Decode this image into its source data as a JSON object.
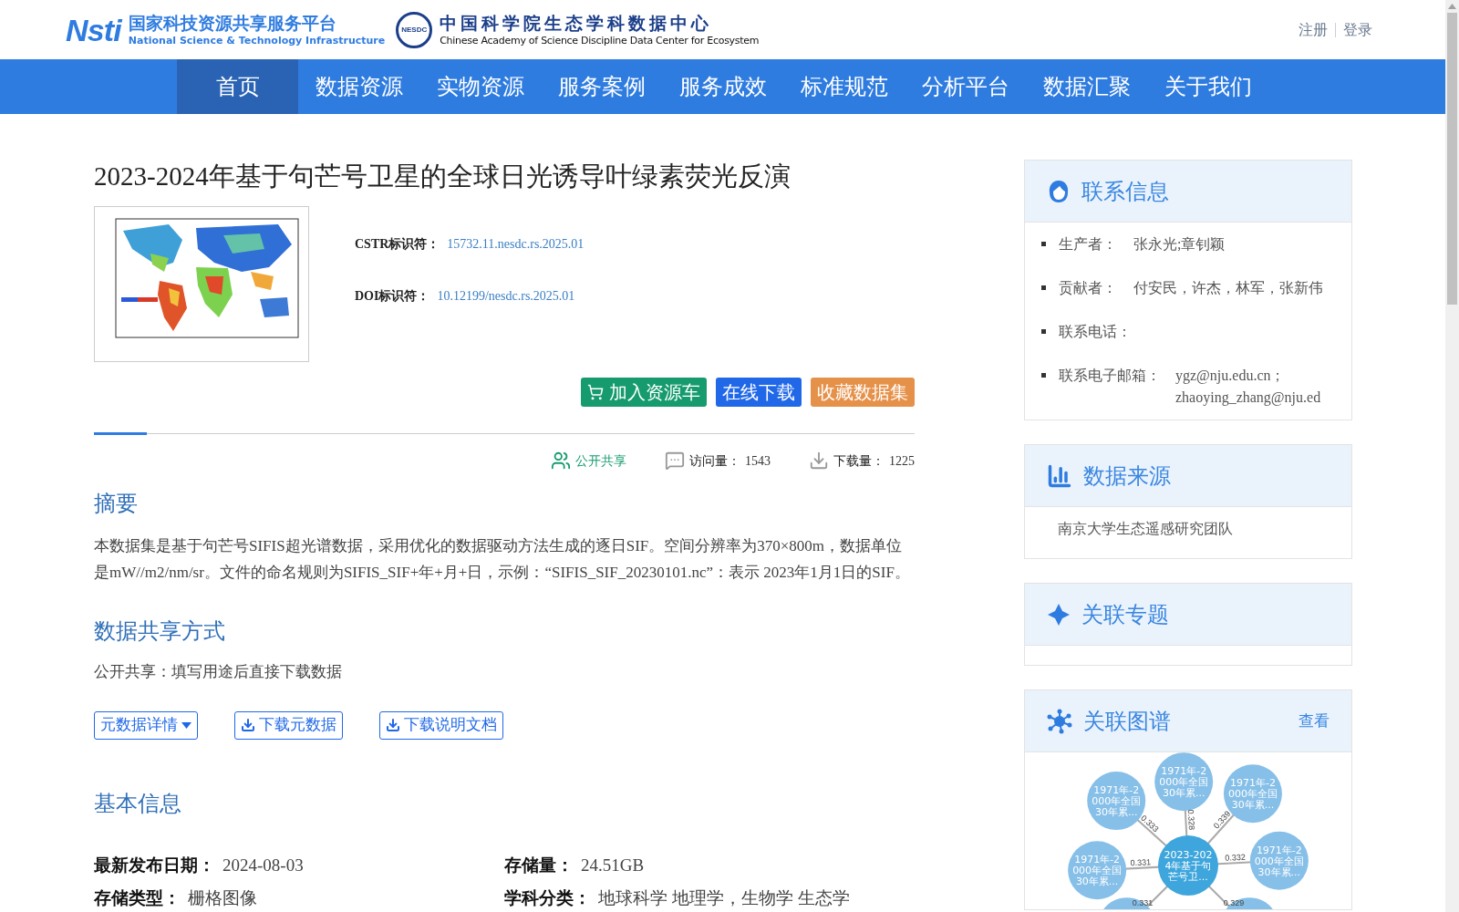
{
  "header": {
    "logos": [
      {
        "kind": "nsti",
        "mark": "Nsti",
        "title": "国家科技资源共享服务平台",
        "subtitle": "National Science & Technology Infrastructure"
      },
      {
        "kind": "nesdc",
        "mark": "NESDC",
        "title": "中国科学院生态学科数据中心",
        "subtitle": "Chinese Academy of Science Discipline Data Center for Ecosystem"
      }
    ],
    "auth_links": [
      "注册",
      "登录"
    ]
  },
  "nav": [
    {
      "label": "首页",
      "selected": true
    },
    {
      "label": "数据资源",
      "selected": false
    },
    {
      "label": "实物资源",
      "selected": false
    },
    {
      "label": "服务案例",
      "selected": false
    },
    {
      "label": "服务成效",
      "selected": false
    },
    {
      "label": "标准规范",
      "selected": false
    },
    {
      "label": "分析平台",
      "selected": false
    },
    {
      "label": "数据汇聚",
      "selected": false
    },
    {
      "label": "关于我们",
      "selected": false
    }
  ],
  "dataset": {
    "title": "2023-2024年基于句芒号卫星的全球日光诱导叶绿素荧光反演",
    "identifiers": [
      {
        "label": "CSTR标识符：",
        "value": "15732.11.nesdc.rs.2025.01"
      },
      {
        "label": "DOI标识符：",
        "value": "10.12199/nesdc.rs.2025.01"
      }
    ],
    "actions": [
      {
        "kind": "cart",
        "label": "加入资源车"
      },
      {
        "kind": "download",
        "label": "在线下载"
      },
      {
        "kind": "favorite",
        "label": "收藏数据集"
      }
    ],
    "stats": [
      {
        "kind": "share",
        "label": "公开共享"
      },
      {
        "kind": "visits",
        "label": "访问量：",
        "value": "1543"
      },
      {
        "kind": "downloads",
        "label": "下载量：",
        "value": "1225"
      }
    ],
    "abstract": {
      "heading": "摘要",
      "text": "本数据集是基于句芒号SIFIS超光谱数据，采用优化的数据驱动方法生成的逐日SIF。空间分辨率为370×800m，数据单位是mW//m2/nm/sr。文件的命名规则为SIFIS_SIF+年+月+日，示例：“SIFIS_SIF_20230101.nc”：表示 2023年1月1日的SIF。"
    },
    "sharing": {
      "heading": "数据共享方式",
      "text": "公开共享：填写用途后直接下载数据"
    },
    "doc_buttons": [
      {
        "kind": "dropdown",
        "label": "元数据详情"
      },
      {
        "kind": "download",
        "label": "下载元数据"
      },
      {
        "kind": "download",
        "label": "下载说明文档"
      }
    ],
    "basic_info": {
      "heading": "基本信息",
      "fields": [
        {
          "label": "最新发布日期：",
          "value": "2024-08-03"
        },
        {
          "label": "存储量：",
          "value": "24.51GB"
        },
        {
          "label": "存储类型：",
          "value": "栅格图像"
        },
        {
          "label": "学科分类：",
          "value": "地球科学 地理学，生物学 生态学"
        }
      ]
    }
  },
  "sidebar": {
    "contact": {
      "title": "联系信息",
      "items": [
        {
          "label": "生产者：",
          "value": "张永光;章钊颖"
        },
        {
          "label": "贡献者：",
          "value": "付安民，许杰，林军，张新伟"
        },
        {
          "label": "联系电话："
        },
        {
          "label": "联系电子邮箱：",
          "value": "ygz@nju.edu.cn；zhaoying_zhang@nju.ed"
        }
      ]
    },
    "source": {
      "title": "数据来源",
      "text": "南京大学生态遥感研究团队"
    },
    "topics": {
      "title": "关联专题"
    },
    "graph": {
      "title": "关联图谱",
      "link": "查看",
      "center": [
        "2023-202",
        "4年基于句",
        "芒号卫..."
      ],
      "nodes": [
        {
          "lines": [
            "1971年-2",
            "000年全国",
            "30年累..."
          ],
          "weight": "0.328"
        },
        {
          "lines": [
            "1971年-2",
            "000年全国",
            "30年累..."
          ],
          "weight": "0.333"
        },
        {
          "lines": [
            "1971年-2",
            "000年全国",
            "30年累..."
          ],
          "weight": "0.339"
        },
        {
          "lines": [
            "1971年-2",
            "000年全国",
            "30年累..."
          ],
          "weight": "0.331"
        },
        {
          "lines": [
            "1971年-2",
            "000年全国",
            "30年累..."
          ],
          "weight": "0.332"
        },
        {
          "weight": "0.331"
        },
        {
          "weight": "0.329"
        }
      ]
    }
  }
}
